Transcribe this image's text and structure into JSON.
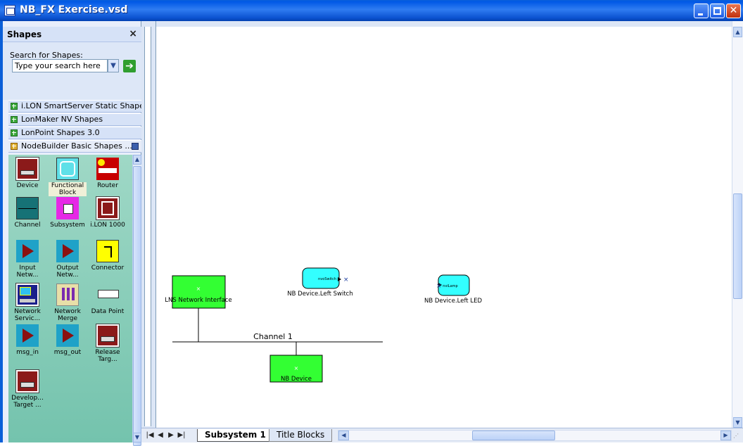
{
  "window": {
    "title": "NB_FX Exercise.vsd",
    "close_glyph": "✕"
  },
  "shapes_pane": {
    "title": "Shapes",
    "close": "×",
    "search_label": "Search for Shapes:",
    "search_placeholder": "Type your search here",
    "stencils": [
      {
        "label": "i.LON SmartServer Static Shapes"
      },
      {
        "label": "LonMaker NV Shapes"
      },
      {
        "label": "LonPoint Shapes 3.0"
      },
      {
        "label": "NodeBuilder Basic Shapes ..."
      }
    ],
    "masters": [
      {
        "label": "Device",
        "icon": "device-icon"
      },
      {
        "label": "Functional\nBlock",
        "icon": "functional-block-icon"
      },
      {
        "label": "Router",
        "icon": "router-icon"
      },
      {
        "label": "Channel",
        "icon": "channel-icon"
      },
      {
        "label": "Subsystem",
        "icon": "subsystem-icon"
      },
      {
        "label": "i.LON 1000",
        "icon": "ilon-1000-icon"
      },
      {
        "label": "Input\nNetw...",
        "icon": "input-network-icon"
      },
      {
        "label": "Output\nNetw...",
        "icon": "output-network-icon"
      },
      {
        "label": "Connector",
        "icon": "connector-icon"
      },
      {
        "label": "Network\nServic...",
        "icon": "network-service-icon"
      },
      {
        "label": "Network\nMerge",
        "icon": "network-merge-icon"
      },
      {
        "label": "Data Point",
        "icon": "data-point-icon"
      },
      {
        "label": "msg_in",
        "icon": "msg-in-icon"
      },
      {
        "label": "msg_out",
        "icon": "msg-out-icon"
      },
      {
        "label": "Release\nTarg...",
        "icon": "release-target-icon"
      },
      {
        "label": "Develop...\nTarget ...",
        "icon": "develop-target-icon"
      }
    ]
  },
  "drawing": {
    "channel_label": "Channel 1",
    "shapes": {
      "lns_label": "LNS Network Interface",
      "switch_label": "NB Device.Left Switch",
      "switch_inner": "nvoSwitch",
      "led_label": "NB Device.Left LED",
      "led_inner": "nviLamp",
      "nbdevice_label": "NB Device",
      "center_glyph": "×"
    },
    "colors": {
      "device_fill": "#33ff33",
      "fb_fill": "#33ffff"
    }
  },
  "tabs": {
    "active": "Subsystem 1",
    "inactive": "Title Blocks",
    "nav": [
      "|◀",
      "◀",
      "▶",
      "▶|"
    ]
  },
  "scrollbars": {
    "thumb_mark": "|||"
  }
}
